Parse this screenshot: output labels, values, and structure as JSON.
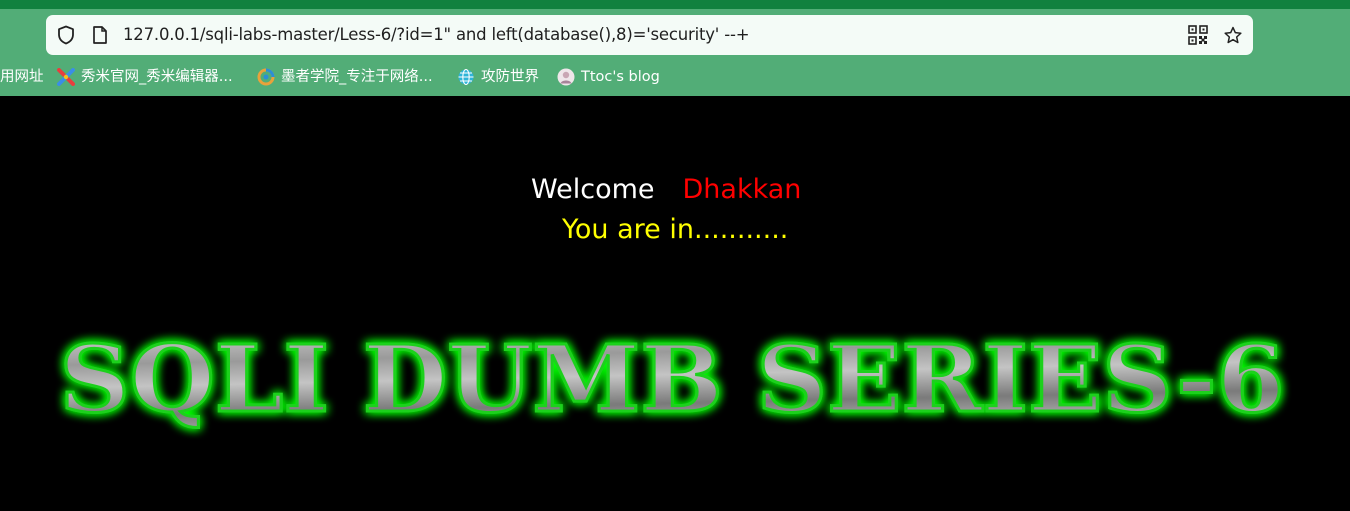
{
  "browser": {
    "url": "127.0.0.1/sqli-labs-master/Less-6/?id=1\" and left(database(),8)='security' --+",
    "bookmarks": [
      {
        "label": "用网址",
        "icon": "none"
      },
      {
        "label": "秀米官网_秀米编辑器...",
        "icon": "xiumi-icon"
      },
      {
        "label": "墨者学院_专注于网络...",
        "icon": "mozhe-icon"
      },
      {
        "label": "攻防世界",
        "icon": "globe-icon"
      },
      {
        "label": "Ttoc's blog",
        "icon": "avatar-icon"
      }
    ],
    "colors": {
      "toolbar": "#52ad77",
      "topline": "#11813f",
      "addressbar": "#f4fbf7"
    }
  },
  "page": {
    "welcome": "Welcome",
    "name": "Dhakkan",
    "status": "You are in...........",
    "banner_text": "SQLI DUMB SERIES-6",
    "colors": {
      "background": "#000000",
      "welcome": "#ffffff",
      "name": "#ff0000",
      "status": "#ffff00",
      "glow": "#00ff00"
    }
  }
}
